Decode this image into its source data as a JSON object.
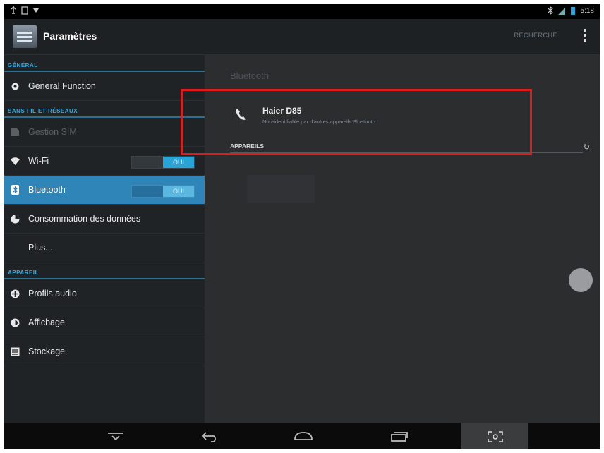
{
  "status_bar": {
    "time": "5:18"
  },
  "action_bar": {
    "title": "Paramètres",
    "action_label": "RECHERCHE"
  },
  "sidebar": {
    "sections": [
      {
        "title": "GÉNÉRAL"
      },
      {
        "title": "SANS FIL ET RÉSEAUX"
      },
      {
        "title": "APPAREIL"
      }
    ],
    "items": {
      "general": {
        "label": "General Function"
      },
      "sim": {
        "label": "Gestion SIM"
      },
      "wifi": {
        "label": "Wi-Fi",
        "toggle": "OUI"
      },
      "bluetooth": {
        "label": "Bluetooth",
        "toggle": "OUI"
      },
      "data": {
        "label": "Consommation des données"
      },
      "more": {
        "label": "Plus..."
      },
      "audio": {
        "label": "Profils audio"
      },
      "display": {
        "label": "Affichage"
      },
      "storage": {
        "label": "Stockage"
      }
    }
  },
  "content": {
    "paired_heading": "Bluetooth",
    "device": {
      "name": "Haier D85",
      "subtitle": "Non-identifiable par d'autres appareils Bluetooth"
    },
    "devices_section": "APPAREILS",
    "refresh": "↻"
  },
  "colors": {
    "accent": "#2f85b8",
    "highlight": "#e01b1b",
    "section": "#3aa7d9"
  }
}
